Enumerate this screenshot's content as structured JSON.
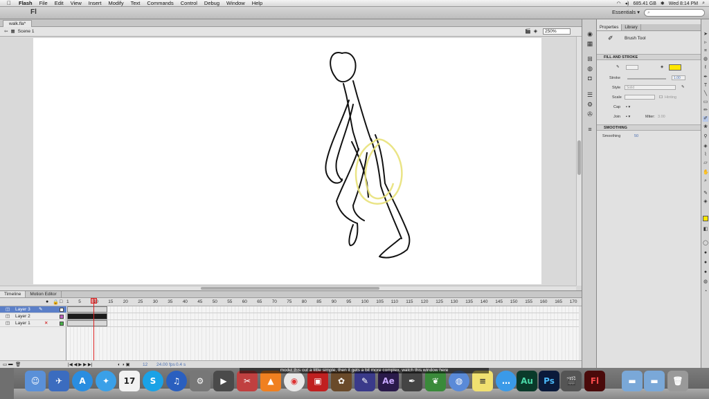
{
  "menubar": {
    "apple": "",
    "items": [
      "Flash",
      "File",
      "Edit",
      "View",
      "Insert",
      "Modify",
      "Text",
      "Commands",
      "Control",
      "Debug",
      "Window",
      "Help"
    ],
    "disk": "685.41 GB",
    "clock": "Wed 8:14 PM"
  },
  "appbar": {
    "logo": "Fl",
    "workspace": "Essentials ▾",
    "search_placeholder": ""
  },
  "document": {
    "tab": "walk.fla*",
    "scene": "Scene 1",
    "zoom": "250%"
  },
  "timeline": {
    "tabs": [
      "Timeline",
      "Motion Editor"
    ],
    "ruler": [
      "1",
      "5",
      "10",
      "15",
      "20",
      "25",
      "30",
      "35",
      "40",
      "45",
      "50",
      "55",
      "60",
      "65",
      "70",
      "75",
      "80",
      "85",
      "90",
      "95",
      "100",
      "105",
      "110",
      "115",
      "120",
      "125",
      "130",
      "135",
      "140",
      "145",
      "150",
      "155",
      "160",
      "165",
      "170"
    ],
    "layers": [
      "Layer 3",
      "Layer 2",
      "Layer 1"
    ],
    "current_frame": "12",
    "fps": "24.00 fps",
    "time": "0.4 s",
    "frame_label": "12"
  },
  "properties": {
    "tabs": [
      "Properties",
      "Library"
    ],
    "tool": "Brush Tool",
    "sections": {
      "fill_stroke": "FILL AND STROKE",
      "smoothing": "SMOOTHING"
    },
    "stroke_label": "Stroke",
    "stroke_value": "1.00",
    "style_label": "Style",
    "style_value": "Solid",
    "scale_label": "Scale",
    "hinting_label": "Hinting",
    "cap_label": "Cap",
    "join_label": "Join",
    "miter_label": "Miter:",
    "miter_value": "3.00",
    "smoothing_label": "Smoothing",
    "smoothing_value": "50",
    "fill_color": "#ffe600"
  },
  "subtitle": "model this out a little simple, then it gets a bit more complex. watch this window here",
  "dock": [
    "Finder",
    "Safari",
    "Mail",
    "iCal",
    "Skype",
    "iTunes",
    "Flash",
    "Chrome",
    "Illustrator",
    "After Effects",
    "Photoshop",
    "Evernote",
    "Notes",
    "Messages",
    "Audition"
  ]
}
